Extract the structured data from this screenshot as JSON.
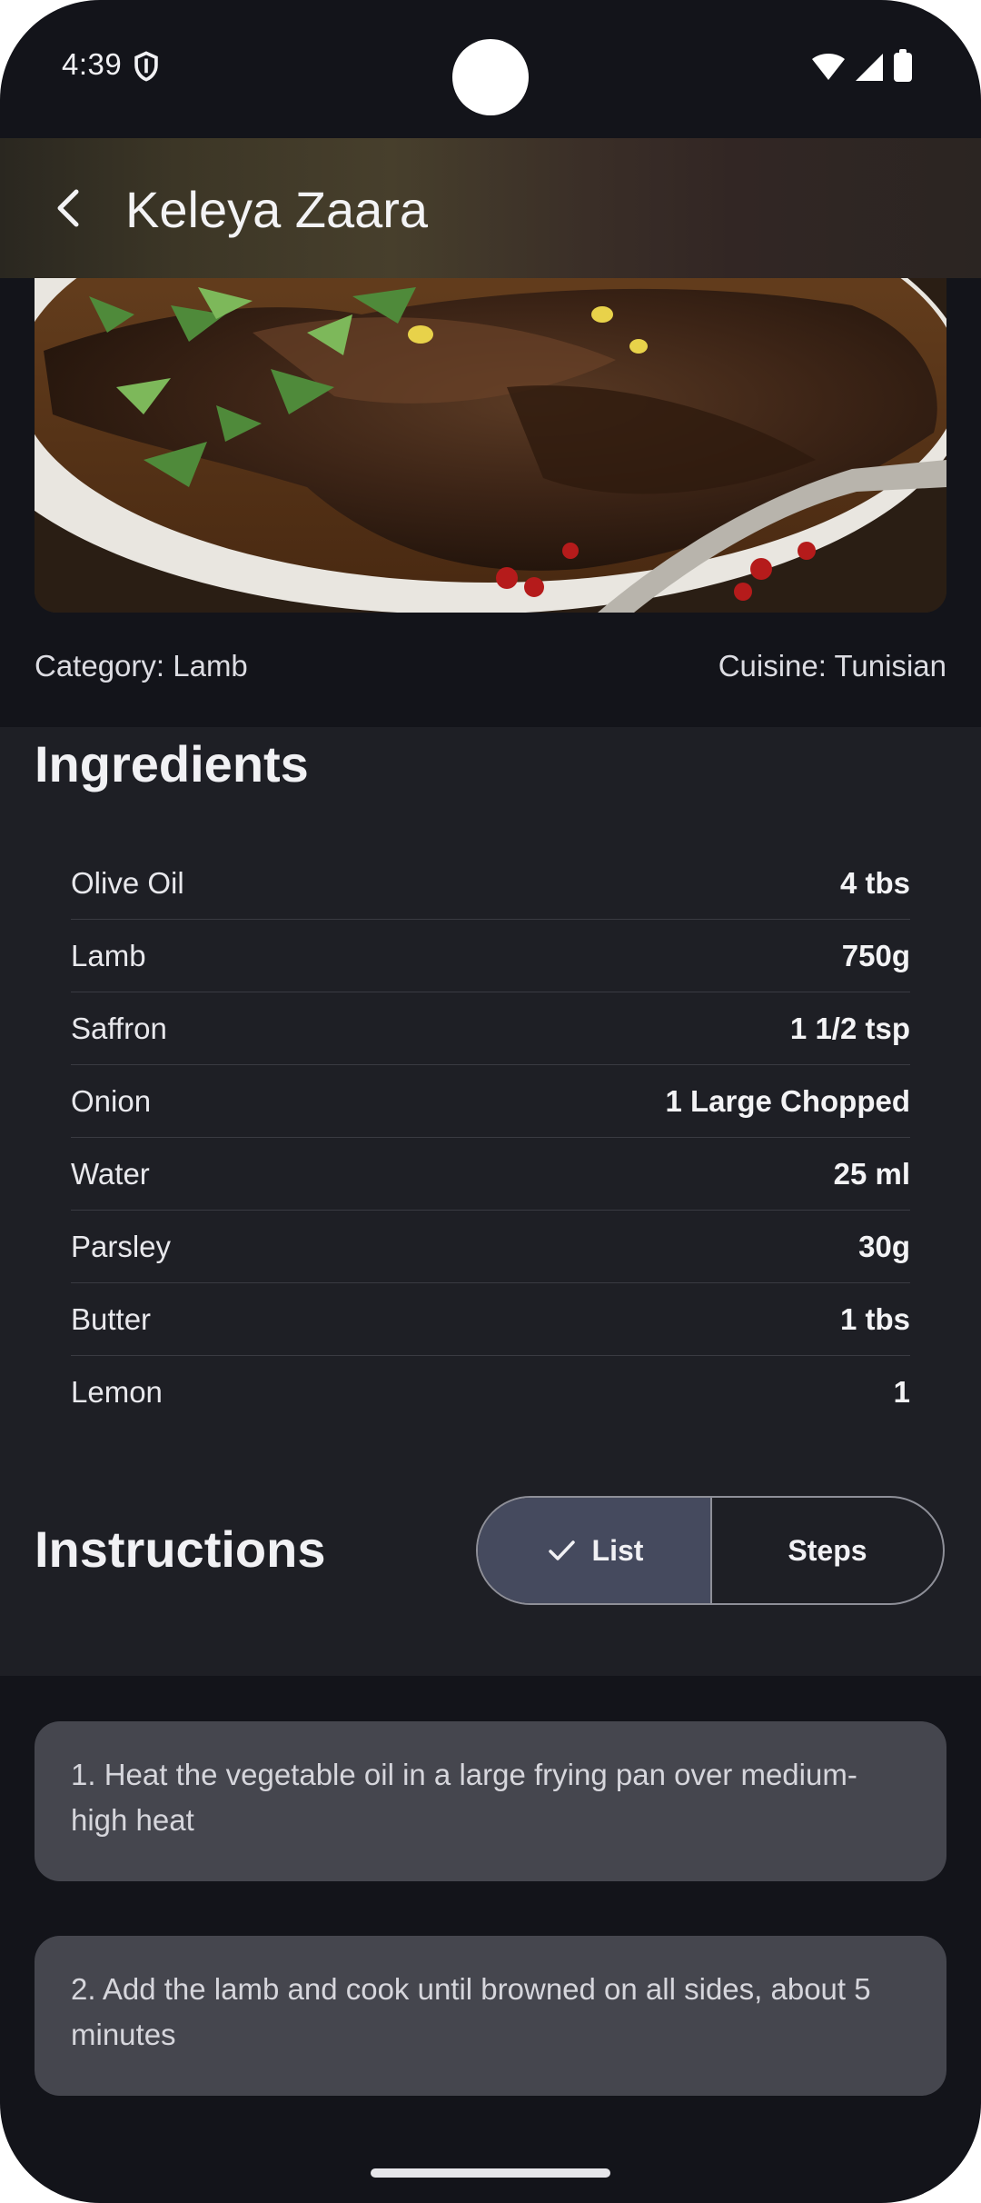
{
  "status": {
    "time": "4:39"
  },
  "header": {
    "title": "Keleya Zaara"
  },
  "meta": {
    "category": "Category: Lamb",
    "cuisine": "Cuisine: Tunisian"
  },
  "ingredients": {
    "title": "Ingredients",
    "items": [
      {
        "name": "Olive Oil",
        "qty": "4 tbs"
      },
      {
        "name": "Lamb",
        "qty": "750g"
      },
      {
        "name": "Saffron",
        "qty": "1 1/2 tsp"
      },
      {
        "name": "Onion",
        "qty": "1 Large Chopped"
      },
      {
        "name": "Water",
        "qty": "25 ml"
      },
      {
        "name": "Parsley",
        "qty": "30g"
      },
      {
        "name": "Butter",
        "qty": "1 tbs"
      },
      {
        "name": "Lemon",
        "qty": "1"
      }
    ]
  },
  "instructions": {
    "title": "Instructions",
    "toggle": {
      "list_label": "List",
      "steps_label": "Steps",
      "selected": "List"
    },
    "steps": [
      "1. Heat the vegetable oil in a large frying pan over medium-high heat",
      "2. Add the lamb and cook until browned on all sides, about 5 minutes"
    ]
  },
  "colors": {
    "background": "#13141a",
    "panel": "#1e1f25",
    "card": "#45464e",
    "toggle_selected": "#454a5e"
  }
}
